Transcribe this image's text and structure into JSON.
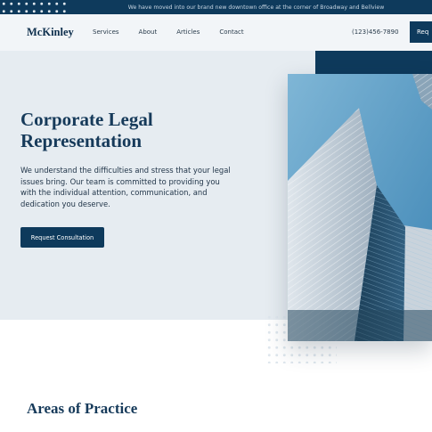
{
  "announcement": "We have moved into our brand new downtown office at the corner of Broadway and Bellview",
  "brand": {
    "name": "McKinley"
  },
  "nav": {
    "links": [
      "Services",
      "About",
      "Articles",
      "Contact"
    ],
    "phone": "(123)456-7890",
    "cta_label": "Req"
  },
  "hero": {
    "title_line1": "Corporate Legal",
    "title_line2": "Representation",
    "text": "We understand the difficulties and stress that your legal issues bring. Our team is committed to providing you with the individual attention, communication, and dedication you deserve.",
    "button_label": "Request Consultation"
  },
  "practice": {
    "title": "Areas of Practice"
  },
  "colors": {
    "brand_navy": "#0e3a5c",
    "hero_bg": "#e6ecf1",
    "sky": "#4f9bc7"
  }
}
